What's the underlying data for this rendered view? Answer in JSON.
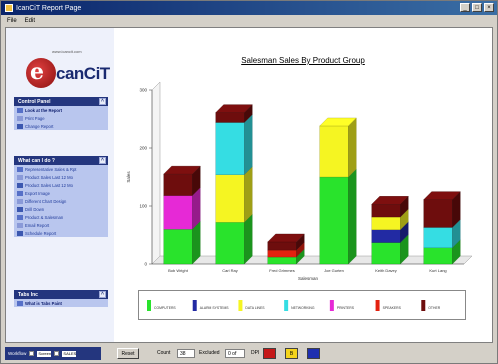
{
  "window": {
    "title": "IcanCiT Report Page",
    "minimize_glyph": "_",
    "maximize_glyph": "□",
    "close_glyph": "×"
  },
  "menu": [
    "File",
    "Edit"
  ],
  "logo": {
    "tagline": "www.icancit.com",
    "letter": "e",
    "word": "canCiT"
  },
  "panels": [
    {
      "title": "Control Panel",
      "items": [
        {
          "label": "Look at the Report",
          "icon": "magnifier-icon",
          "strong": true
        },
        {
          "label": "Print Page",
          "icon": "printer-icon"
        },
        {
          "label": "Change Report",
          "icon": "pencil-icon"
        }
      ]
    },
    {
      "title": "What can I do ?",
      "items": [
        {
          "label": "Representative Sales & Rpt",
          "icon": "report-icon"
        },
        {
          "label": "Product Sales Last 12 Mo",
          "icon": "report-icon"
        },
        {
          "label": "Product Sales Last 12 Mo",
          "icon": "report-icon"
        },
        {
          "label": "Export Image",
          "icon": "image-icon"
        },
        {
          "label": "Different Chart Design",
          "icon": "chart-icon"
        },
        {
          "label": "Drill Down",
          "icon": "drill-icon"
        },
        {
          "label": "Product & Salesman",
          "icon": "people-icon"
        },
        {
          "label": "Email Report",
          "icon": "mail-icon"
        },
        {
          "label": "Schedule Report",
          "icon": "clock-icon"
        }
      ]
    },
    {
      "title": "Tabs Inc",
      "items": [
        {
          "label": "What is Tabs Paint",
          "icon": "help-icon",
          "strong": true
        }
      ]
    }
  ],
  "statusbar": {
    "left_label": "Workflow",
    "left_select": "Screen",
    "left_select_2": "SALES",
    "reset_button": "Reset",
    "count_label": "Count",
    "count_value": "38",
    "excluded_label": "Excluded",
    "excluded_value": "0 of",
    "page_label": "DPI",
    "swatches": [
      {
        "color": "#c41818",
        "label": ""
      },
      {
        "color": "#f4d41c",
        "label": "B"
      },
      {
        "color": "#1f2fb0",
        "label": ""
      }
    ]
  },
  "chart_data": {
    "type": "bar",
    "stacked": true,
    "three_d": true,
    "title": "Salesman Sales By Product Group",
    "xlabel": "Salesman",
    "ylabel": "Sales",
    "ylim": [
      0,
      300
    ],
    "yticks": [
      0,
      100,
      200,
      300
    ],
    "ytick_labels": [
      "0",
      "100",
      "200",
      "300"
    ],
    "categories": [
      "Bob Wright",
      "Carl Ray",
      "Fred Grimmes",
      "Joe Gurten",
      "Keith Davey",
      "Kurt Lang"
    ],
    "series": [
      {
        "name": "COMPUTERS",
        "color": "#29e32c",
        "values": [
          60,
          72,
          12,
          150,
          37,
          28
        ]
      },
      {
        "name": "ALARM SYSTEMS",
        "color": "#222aa3",
        "values": [
          0,
          0,
          0,
          0,
          22,
          0
        ]
      },
      {
        "name": "DATA LINES",
        "color": "#f5f522",
        "values": [
          0,
          82,
          0,
          88,
          22,
          0
        ]
      },
      {
        "name": "NETWORKING",
        "color": "#35dde3",
        "values": [
          0,
          90,
          0,
          0,
          0,
          35
        ]
      },
      {
        "name": "PRINTERS",
        "color": "#e629d6",
        "values": [
          58,
          0,
          0,
          0,
          0,
          0
        ]
      },
      {
        "name": "SPEAKERS",
        "color": "#e3210f",
        "values": [
          0,
          0,
          12,
          0,
          0,
          0
        ]
      },
      {
        "name": "OTHER",
        "color": "#6e0d0d",
        "values": [
          37,
          17,
          14,
          0,
          22,
          48
        ]
      }
    ],
    "legend_position": "bottom"
  }
}
